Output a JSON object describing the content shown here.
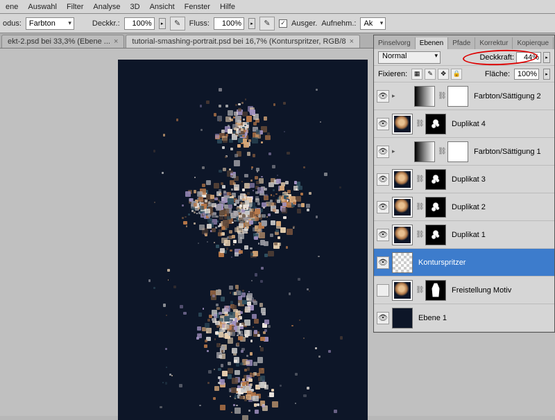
{
  "menu": [
    "ene",
    "Auswahl",
    "Filter",
    "Analyse",
    "3D",
    "Ansicht",
    "Fenster",
    "Hilfe"
  ],
  "opt": {
    "modus": "odus:",
    "mode_val": "Farbton",
    "deckr": "Deckkr.:",
    "deckr_val": "100%",
    "fluss": "Fluss:",
    "fluss_val": "100%",
    "ausger": "Ausger.",
    "aufnehm": "Aufnehm.:",
    "aufnehm_val": "Ak"
  },
  "tabs": [
    {
      "label": "ekt-2.psd bei 33,3% (Ebene ...",
      "active": false
    },
    {
      "label": "tutorial-smashing-portrait.psd bei 16,7% (Konturspritzer, RGB/8",
      "active": true
    }
  ],
  "panel": {
    "tabs": [
      "Pinselvorg",
      "Ebenen",
      "Pfade",
      "Korrektur",
      "Kopierque"
    ],
    "active_tab": 1,
    "blend": "Normal",
    "deck_label": "Deckkraft:",
    "deck_val": "44%",
    "fix_label": "Fixieren:",
    "flache_label": "Fläche:",
    "flache_val": "100%"
  },
  "layers": [
    {
      "eye": true,
      "type": "adj",
      "name": "Farbton/Sättigung 2",
      "indent": 1
    },
    {
      "eye": true,
      "type": "img_mask",
      "name": "Duplikat 4",
      "indent": 0
    },
    {
      "eye": true,
      "type": "adj",
      "name": "Farbton/Sättigung 1",
      "indent": 1
    },
    {
      "eye": true,
      "type": "img_mask",
      "name": "Duplikat 3",
      "indent": 0
    },
    {
      "eye": true,
      "type": "img_mask",
      "name": "Duplikat 2",
      "indent": 0
    },
    {
      "eye": true,
      "type": "img_mask",
      "name": "Duplikat 1",
      "indent": 0
    },
    {
      "eye": true,
      "type": "trans",
      "name": "Konturspritzer",
      "indent": 0,
      "sel": true
    },
    {
      "eye": false,
      "type": "img_whitemask",
      "name": "Freistellung Motiv",
      "indent": 0
    },
    {
      "eye": true,
      "type": "dark",
      "name": "Ebene 1",
      "indent": 0
    }
  ]
}
